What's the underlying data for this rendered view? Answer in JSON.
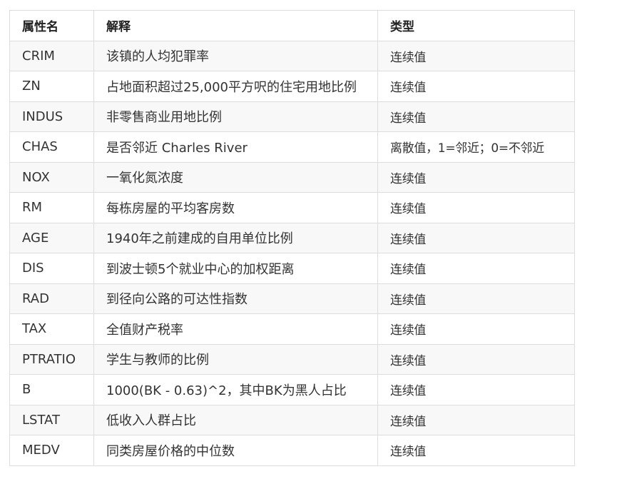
{
  "table": {
    "headers": [
      "属性名",
      "解释",
      "类型"
    ],
    "rows": [
      [
        "CRIM",
        "该镇的人均犯罪率",
        "连续值"
      ],
      [
        "ZN",
        "占地面积超过25,000平方呎的住宅用地比例",
        "连续值"
      ],
      [
        "INDUS",
        "非零售商业用地比例",
        "连续值"
      ],
      [
        "CHAS",
        "是否邻近 Charles River",
        "离散值，1=邻近；0=不邻近"
      ],
      [
        "NOX",
        "一氧化氮浓度",
        "连续值"
      ],
      [
        "RM",
        "每栋房屋的平均客房数",
        "连续值"
      ],
      [
        "AGE",
        "1940年之前建成的自用单位比例",
        "连续值"
      ],
      [
        "DIS",
        "到波士顿5个就业中心的加权距离",
        "连续值"
      ],
      [
        "RAD",
        "到径向公路的可达性指数",
        "连续值"
      ],
      [
        "TAX",
        "全值财产税率",
        "连续值"
      ],
      [
        "PTRATIO",
        "学生与教师的比例",
        "连续值"
      ],
      [
        "B",
        "1000(BK - 0.63)^2，其中BK为黑人占比",
        "连续值"
      ],
      [
        "LSTAT",
        "低收入人群占比",
        "连续值"
      ],
      [
        "MEDV",
        "同类房屋价格的中位数",
        "连续值"
      ]
    ]
  }
}
